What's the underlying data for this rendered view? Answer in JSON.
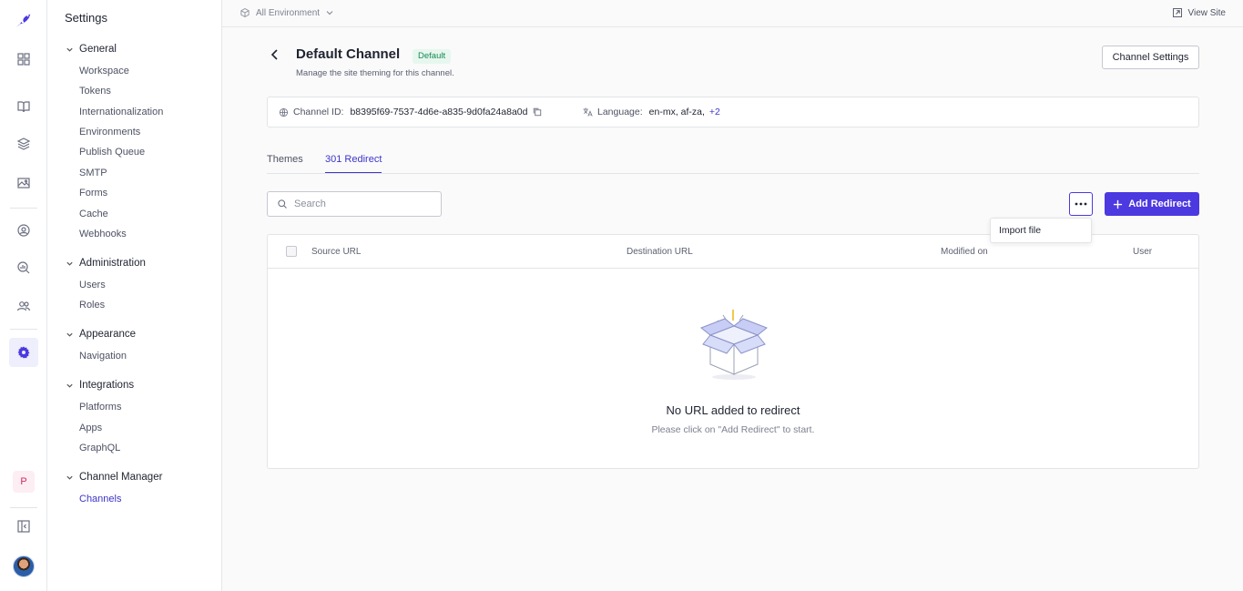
{
  "sidebar": {
    "title": "Settings",
    "groups": [
      {
        "label": "General",
        "items": [
          "Workspace",
          "Tokens",
          "Internationalization",
          "Environments",
          "Publish Queue",
          "SMTP",
          "Forms",
          "Cache",
          "Webhooks"
        ]
      },
      {
        "label": "Administration",
        "items": [
          "Users",
          "Roles"
        ]
      },
      {
        "label": "Appearance",
        "items": [
          "Navigation"
        ]
      },
      {
        "label": "Integrations",
        "items": [
          "Platforms",
          "Apps",
          "GraphQL"
        ]
      },
      {
        "label": "Channel Manager",
        "items": [
          "Channels"
        ]
      }
    ]
  },
  "rail": {
    "avatar_letter": "P",
    "icons": [
      "logo-bird-icon",
      "dashboard-grid-icon",
      "book-icon",
      "layers-icon",
      "image-icon",
      "user-circle-icon",
      "analytics-icon",
      "users-icon",
      "settings-gear-icon",
      "collapse-panel-icon"
    ]
  },
  "topbar": {
    "environment": "All Environment",
    "view_site": "View Site"
  },
  "header": {
    "title": "Default Channel",
    "badge": "Default",
    "subtitle": "Manage the site theming for this channel.",
    "settings_button": "Channel Settings"
  },
  "info": {
    "channel_id_label": "Channel ID:",
    "channel_id": "b8395f69-7537-4d6e-a835-9d0fa24a8a0d",
    "language_label": "Language:",
    "languages": "en-mx, af-za,",
    "languages_more": "+2"
  },
  "tabs": [
    "Themes",
    "301 Redirect"
  ],
  "toolbar": {
    "search_placeholder": "Search",
    "add_button": "Add Redirect",
    "menu_item": "Import file"
  },
  "table": {
    "columns": [
      "Source URL",
      "Destination URL",
      "Modified on",
      "User"
    ],
    "empty_title": "No URL added to redirect",
    "empty_subtitle": "Please click on \"Add Redirect\" to start."
  },
  "colors": {
    "accent": "#4c39e0",
    "badge_bg": "#e7f7ef",
    "badge_text": "#148a4f"
  }
}
